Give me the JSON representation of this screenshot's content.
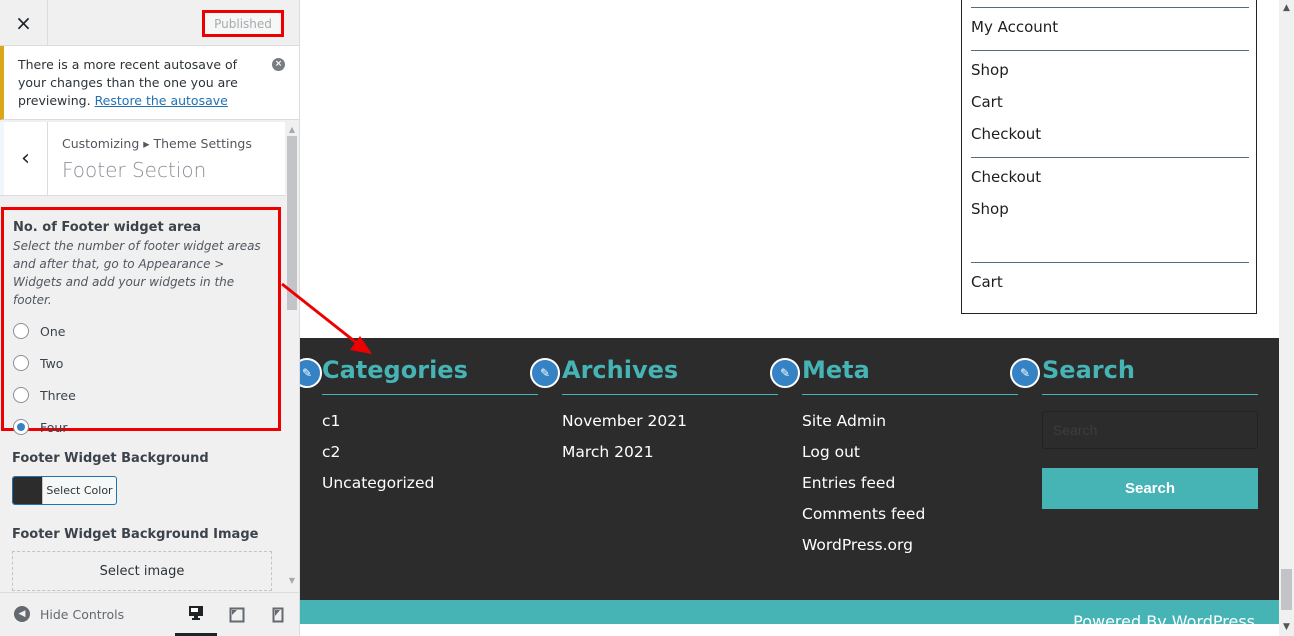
{
  "sidebar": {
    "close_icon": "×",
    "published_label": "Published",
    "notice": {
      "text": "There is a more recent autosave of your changes than the one you are previewing.",
      "link": "Restore the autosave",
      "dismiss_icon": "×"
    },
    "back_icon": "‹",
    "breadcrumb": "Customizing ▸ Theme Settings",
    "section_title": "Footer Section",
    "widget_area": {
      "title": "No. of Footer widget area",
      "description": "Select the number of footer widget areas and after that, go to Appearance > Widgets and add your widgets in the footer.",
      "options": [
        "One",
        "Two",
        "Three",
        "Four"
      ],
      "selected": "Four"
    },
    "bg_label": "Footer Widget Background",
    "bg_color": "#2c2c2c",
    "select_color_label": "Select Color",
    "bg_image_label": "Footer Widget Background Image",
    "select_image_label": "Select image",
    "hide_controls_label": "Hide Controls",
    "devices": [
      "desktop",
      "tablet",
      "mobile"
    ],
    "active_device": "desktop"
  },
  "preview": {
    "menu_items": [
      "My Account",
      "Shop",
      "Cart",
      "Checkout",
      "Checkout",
      "Shop",
      "Cart"
    ],
    "footer_widgets": [
      {
        "title": "Categories",
        "items": [
          "c1",
          "c2",
          "Uncategorized"
        ]
      },
      {
        "title": "Archives",
        "items": [
          "November 2021",
          "March 2021"
        ]
      },
      {
        "title": "Meta",
        "items": [
          "Site Admin",
          "Log out",
          "Entries feed",
          "Comments feed",
          "WordPress.org"
        ]
      },
      {
        "title": "Search",
        "search_placeholder": "Search",
        "search_button": "Search"
      }
    ],
    "copyright": "Powered By WordPress",
    "accent_color": "#46b3b5",
    "footer_bg": "#2c2c2c"
  }
}
